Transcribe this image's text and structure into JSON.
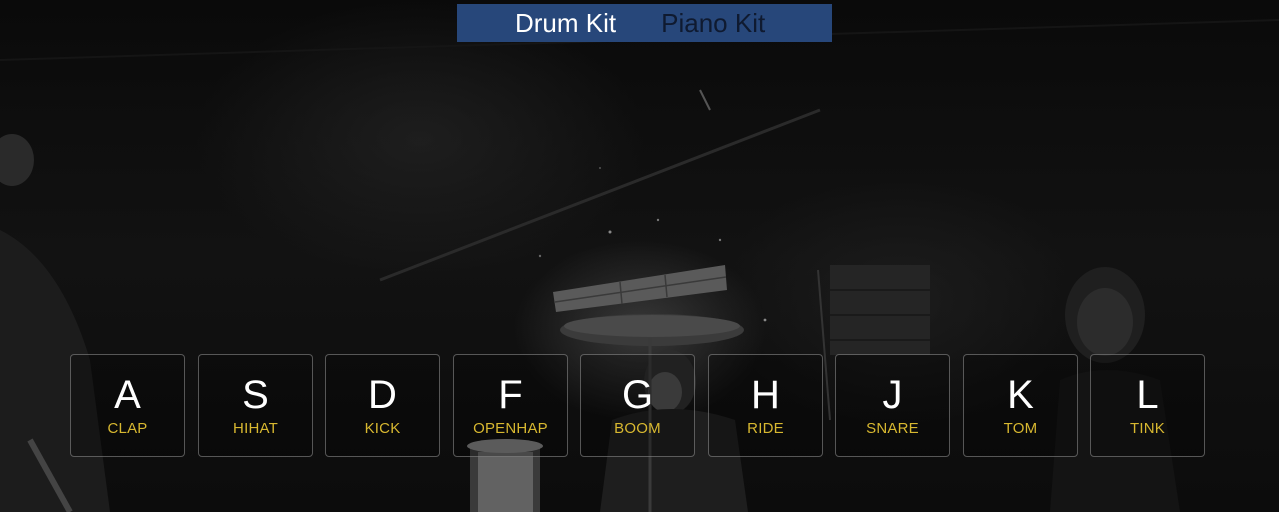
{
  "kit_tabs": {
    "active": "Drum Kit",
    "inactive": "Piano Kit"
  },
  "keys": [
    {
      "letter": "A",
      "sound": "CLAP"
    },
    {
      "letter": "S",
      "sound": "HIHAT"
    },
    {
      "letter": "D",
      "sound": "KICK"
    },
    {
      "letter": "F",
      "sound": "OPENHAP"
    },
    {
      "letter": "G",
      "sound": "BOOM"
    },
    {
      "letter": "H",
      "sound": "RIDE"
    },
    {
      "letter": "J",
      "sound": "SNARE"
    },
    {
      "letter": "K",
      "sound": "TOM"
    },
    {
      "letter": "L",
      "sound": "TINK"
    }
  ],
  "colors": {
    "tab_bar": "#27477a",
    "active_tab_text": "#ffffff",
    "inactive_tab_text": "#0f1a30",
    "key_letter": "#ffffff",
    "key_sound": "#d8b830",
    "key_border": "#7a7a7a"
  },
  "background": {
    "icon": "drummer-stage-photo"
  }
}
